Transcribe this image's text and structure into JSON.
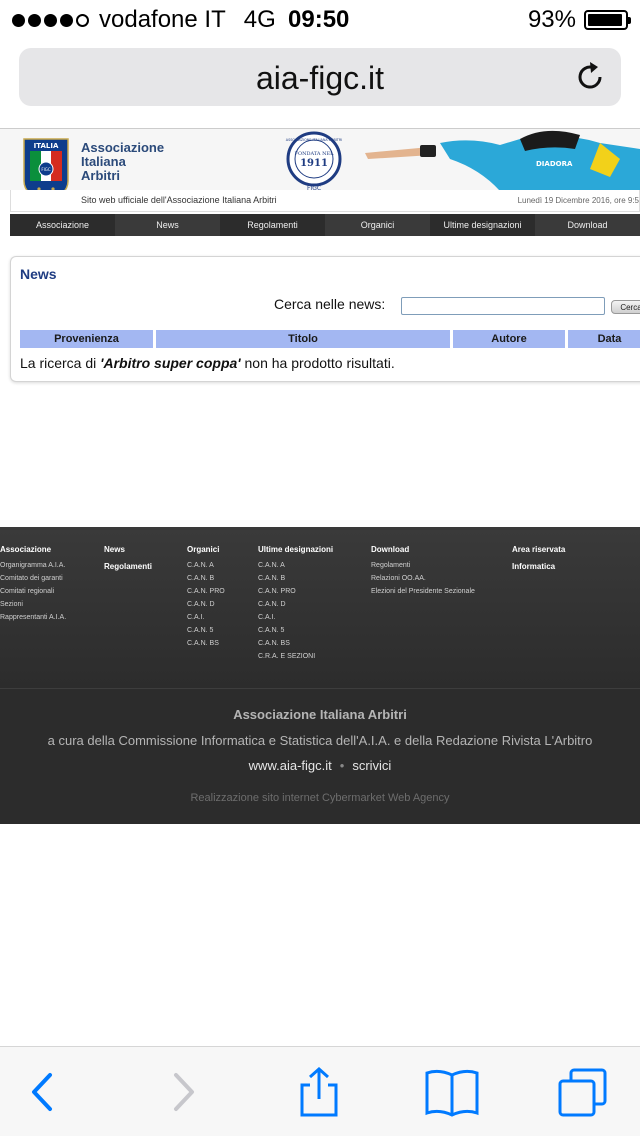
{
  "status_bar": {
    "carrier": "vodafone IT",
    "network": "4G",
    "time": "09:50",
    "battery": "93%",
    "battery_level": 0.93,
    "signal_bars": 4
  },
  "browser": {
    "url": "aia-figc.it",
    "reload_icon": "reload-icon"
  },
  "header": {
    "shield_text": "ITALIA",
    "shield_badge": "FIGC",
    "org_name_line1": "Associazione",
    "org_name_line2": "Italiana",
    "org_name_line3": "Arbitri",
    "seal_top": "ASSOCIAZIONE ITALIANA ARBITRI",
    "seal_founded": "FONDATA NEL",
    "seal_year": "1911",
    "seal_bottom": "FIGC",
    "referee_brand": "DIADORA",
    "tagline": "Sito web ufficiale dell'Associazione Italiana Arbitri",
    "date": "Lunedì 19 Dicembre 2016, ore 9:5"
  },
  "nav": [
    "Associazione",
    "News",
    "Regolamenti",
    "Organici",
    "Ultime designazioni",
    "Download"
  ],
  "news": {
    "title": "News",
    "search_label": "Cerca nelle news:",
    "search_value": "",
    "search_button": "Cerca",
    "columns": [
      "Provenienza",
      "Titolo",
      "Autore",
      "Data"
    ],
    "result_prefix": "La ricerca di ",
    "result_query": "'Arbitro super coppa'",
    "result_suffix": " non ha prodotto risultati."
  },
  "footer": {
    "col_associazione": {
      "title": "Associazione",
      "links": [
        "Organigramma A.I.A.",
        "Comitato dei garanti",
        "Comitati regionali",
        "Sezioni",
        "Rappresentanti A.I.A."
      ]
    },
    "col_news": {
      "title": "News",
      "title2": "Regolamenti"
    },
    "col_organici": {
      "title": "Organici",
      "links": [
        "C.A.N. A",
        "C.A.N. B",
        "C.A.N. PRO",
        "C.A.N. D",
        "C.A.I.",
        "C.A.N. 5",
        "C.A.N. BS"
      ]
    },
    "col_designazioni": {
      "title": "Ultime designazioni",
      "links": [
        "C.A.N. A",
        "C.A.N. B",
        "C.A.N. PRO",
        "C.A.N. D",
        "C.A.I.",
        "C.A.N. 5",
        "C.A.N. BS",
        "C.R.A. E SEZIONI"
      ]
    },
    "col_download": {
      "title": "Download",
      "links": [
        "Regolamenti",
        "Relazioni OO.AA.",
        "Elezioni del Presidente Sezionale"
      ]
    },
    "col_riservata": {
      "title": "Area riservata",
      "title2": "Informatica"
    },
    "org": "Associazione Italiana Arbitri",
    "cura": "a cura della Commissione Informatica e Statistica dell'A.I.A. e della Redazione Rivista L'Arbitro",
    "site_link": "www.aia-figc.it",
    "separator": "•",
    "contact_link": "scrivici",
    "credit_prefix": "Realizzazione sito internet",
    "credit_agency": "Cybermarket Web Agency"
  },
  "toolbar": {
    "back_icon": "back-arrow-icon",
    "forward_icon": "forward-arrow-icon",
    "share_icon": "share-icon",
    "bookmarks_icon": "bookmarks-icon",
    "tabs_icon": "tabs-icon"
  },
  "colors": {
    "accent_blue": "#007aff",
    "nav_dark": "#2c2c2c",
    "table_header": "#a3b7f2",
    "news_title": "#1f3c82",
    "aia_blue": "#2b4a7a"
  }
}
